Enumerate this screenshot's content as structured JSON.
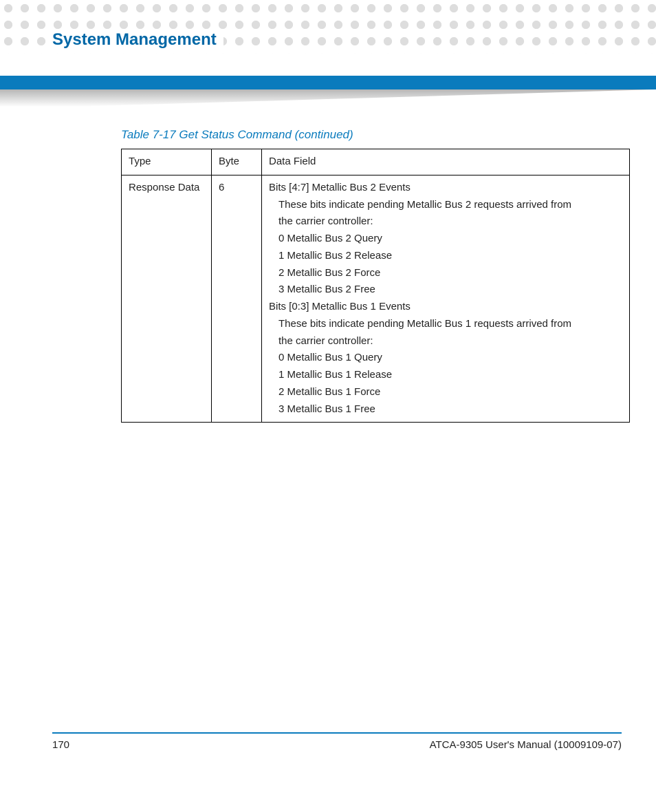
{
  "header": {
    "title": "System Management"
  },
  "table": {
    "caption": "Table 7-17 Get Status Command (continued)",
    "columns": [
      "Type",
      "Byte",
      "Data Field"
    ],
    "row": {
      "type": "Response Data",
      "byte": "6",
      "data": {
        "group1_title": "Bits [4:7] Metallic Bus 2 Events",
        "group1_desc1": "These bits indicate pending Metallic Bus 2 requests arrived from",
        "group1_desc2": "the carrier controller:",
        "group1_items": [
          "0 Metallic Bus 2 Query",
          "1 Metallic Bus 2 Release",
          "2 Metallic Bus 2 Force",
          "3 Metallic Bus 2 Free"
        ],
        "group2_title": "Bits [0:3] Metallic Bus 1 Events",
        "group2_desc1": "These bits indicate pending Metallic Bus 1 requests arrived from",
        "group2_desc2": "the carrier controller:",
        "group2_items": [
          "0 Metallic Bus 1 Query",
          "1 Metallic Bus 1 Release",
          "2 Metallic Bus 1 Force",
          "3 Metallic Bus 1 Free"
        ]
      }
    }
  },
  "footer": {
    "page_number": "170",
    "manual": "ATCA-9305 User's Manual (10009109-07)"
  }
}
